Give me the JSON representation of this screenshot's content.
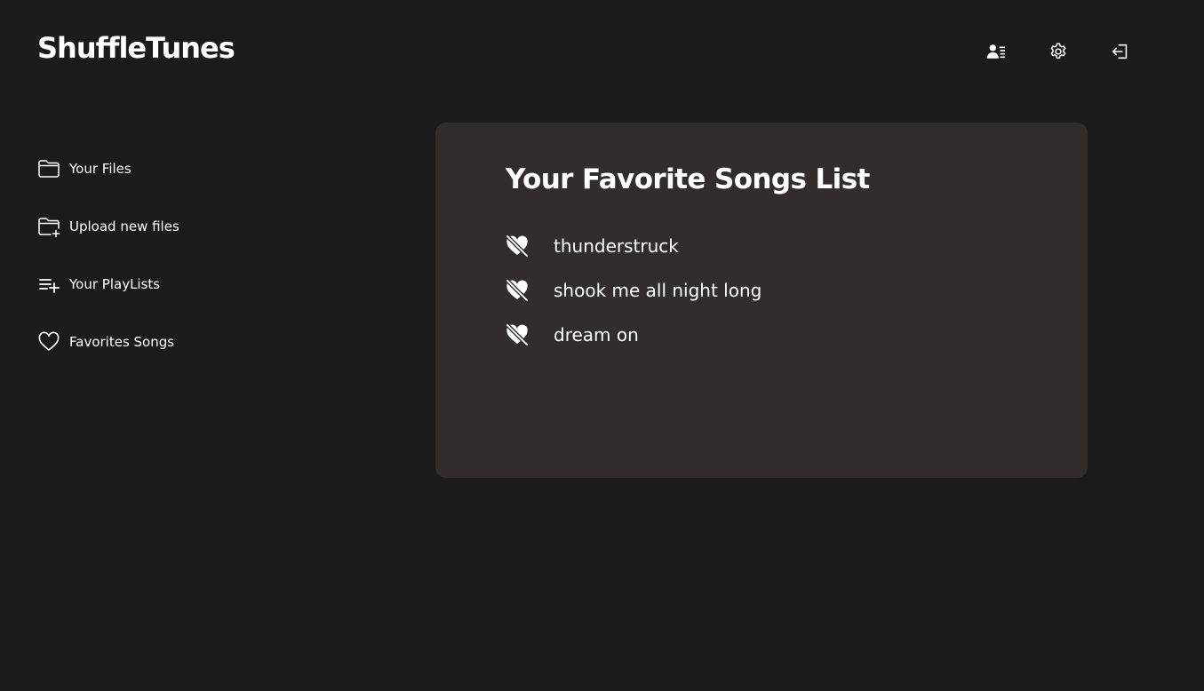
{
  "app": {
    "brand": "ShuffleTunes"
  },
  "header": {
    "actions": [
      {
        "icon": "user-list-icon"
      },
      {
        "icon": "gear-icon"
      },
      {
        "icon": "logout-icon"
      }
    ]
  },
  "sidebar": {
    "items": [
      {
        "label": "Your Files",
        "icon": "folder-icon"
      },
      {
        "label": "Upload new files",
        "icon": "folder-plus-icon"
      },
      {
        "label": "Your PlayLists",
        "icon": "playlist-add-icon"
      },
      {
        "label": "Favorites Songs",
        "icon": "heart-icon"
      }
    ]
  },
  "main": {
    "title": "Your Favorite Songs List",
    "songs": [
      {
        "name": "thunderstruck",
        "icon": "heart-crossed-icon"
      },
      {
        "name": "shook me all night long",
        "icon": "heart-crossed-icon"
      },
      {
        "name": "dream on",
        "icon": "heart-crossed-icon"
      }
    ]
  },
  "colors": {
    "background": "#1c1a1b",
    "card": "#332c2d",
    "text": "#ffffff"
  }
}
